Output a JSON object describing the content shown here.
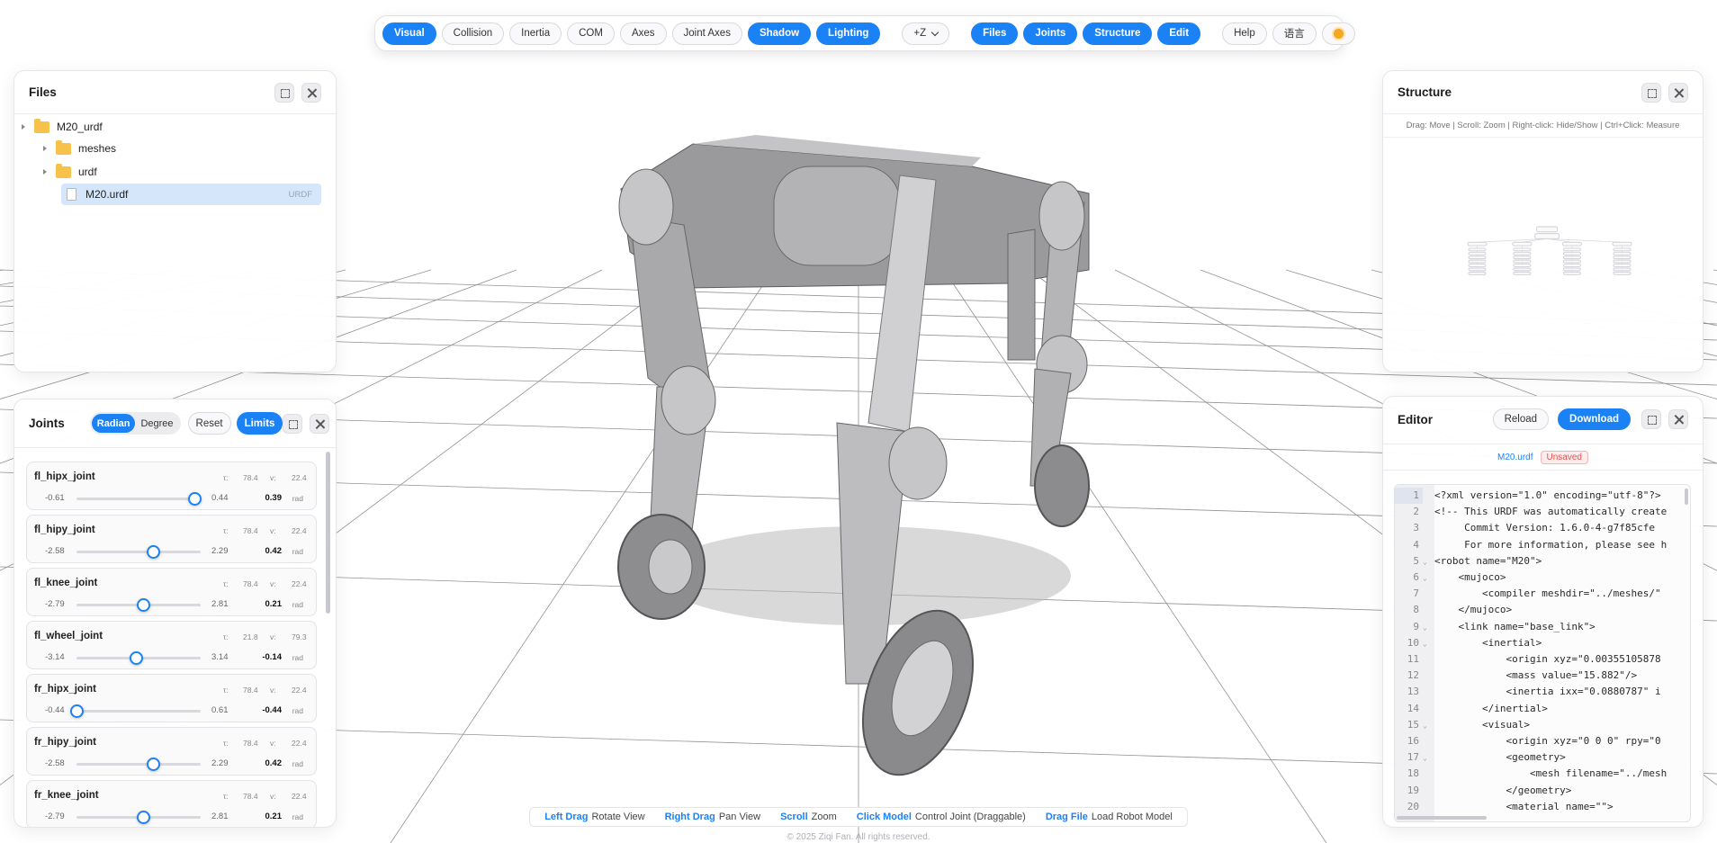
{
  "toolbar": {
    "view_toggles": [
      {
        "label": "Visual",
        "on": true
      },
      {
        "label": "Collision",
        "on": false
      },
      {
        "label": "Inertia",
        "on": false
      },
      {
        "label": "COM",
        "on": false
      },
      {
        "label": "Axes",
        "on": false
      },
      {
        "label": "Joint Axes",
        "on": false
      },
      {
        "label": "Shadow",
        "on": true
      },
      {
        "label": "Lighting",
        "on": true
      }
    ],
    "up_axis": "+Z",
    "panel_toggles": [
      {
        "label": "Files",
        "on": true
      },
      {
        "label": "Joints",
        "on": true
      },
      {
        "label": "Structure",
        "on": true
      },
      {
        "label": "Edit",
        "on": true
      }
    ],
    "help_label": "Help",
    "lang_label": "语言",
    "theme_icon": "sun-icon"
  },
  "files_panel": {
    "title": "Files",
    "tree": [
      {
        "name": "M20_urdf",
        "kind": "folder"
      },
      {
        "name": "meshes",
        "kind": "folder"
      },
      {
        "name": "urdf",
        "kind": "folder"
      },
      {
        "name": "M20.urdf",
        "kind": "file",
        "tag": "URDF",
        "selected": true
      }
    ]
  },
  "structure_panel": {
    "title": "Structure",
    "hint": "Drag: Move | Scroll: Zoom | Right-click: Hide/Show | Ctrl+Click: Measure"
  },
  "joints_panel": {
    "title": "Joints",
    "unit_options": [
      "Radian",
      "Degree"
    ],
    "unit_selected": "Radian",
    "reset_label": "Reset",
    "limits_label": "Limits",
    "joints": [
      {
        "name": "fl_hipx_joint",
        "tau": "78.4",
        "vel": "22.4",
        "min": "-0.61",
        "max": "0.44",
        "value": "0.39",
        "unit": "rad"
      },
      {
        "name": "fl_hipy_joint",
        "tau": "78.4",
        "vel": "22.4",
        "min": "-2.58",
        "max": "2.29",
        "value": "0.42",
        "unit": "rad"
      },
      {
        "name": "fl_knee_joint",
        "tau": "78.4",
        "vel": "22.4",
        "min": "-2.79",
        "max": "2.81",
        "value": "0.21",
        "unit": "rad"
      },
      {
        "name": "fl_wheel_joint",
        "tau": "21.8",
        "vel": "79.3",
        "min": "-3.14",
        "max": "3.14",
        "value": "-0.14",
        "unit": "rad"
      },
      {
        "name": "fr_hipx_joint",
        "tau": "78.4",
        "vel": "22.4",
        "min": "-0.44",
        "max": "0.61",
        "value": "-0.44",
        "unit": "rad"
      },
      {
        "name": "fr_hipy_joint",
        "tau": "78.4",
        "vel": "22.4",
        "min": "-2.58",
        "max": "2.29",
        "value": "0.42",
        "unit": "rad"
      },
      {
        "name": "fr_knee_joint",
        "tau": "78.4",
        "vel": "22.4",
        "min": "-2.79",
        "max": "2.81",
        "value": "0.21",
        "unit": "rad"
      }
    ],
    "tau_label": "τ:",
    "vel_label": "v:"
  },
  "editor_panel": {
    "title": "Editor",
    "reload_label": "Reload",
    "download_label": "Download",
    "filename": "M20.urdf",
    "status": "Unsaved",
    "lines": [
      {
        "n": "1",
        "fold": false,
        "text": "<?xml version=\"1.0\" encoding=\"utf-8\"?>"
      },
      {
        "n": "2",
        "fold": false,
        "text": "<!-- This URDF was automatically create"
      },
      {
        "n": "3",
        "fold": false,
        "text": "     Commit Version: 1.6.0-4-g7f85cfe"
      },
      {
        "n": "4",
        "fold": false,
        "text": "     For more information, please see h"
      },
      {
        "n": "5",
        "fold": true,
        "text": "<robot name=\"M20\">"
      },
      {
        "n": "6",
        "fold": true,
        "text": "    <mujoco>"
      },
      {
        "n": "7",
        "fold": false,
        "text": "        <compiler meshdir=\"../meshes/\""
      },
      {
        "n": "8",
        "fold": false,
        "text": "    </mujoco>"
      },
      {
        "n": "9",
        "fold": true,
        "text": "    <link name=\"base_link\">"
      },
      {
        "n": "10",
        "fold": true,
        "text": "        <inertial>"
      },
      {
        "n": "11",
        "fold": false,
        "text": "            <origin xyz=\"0.00355105878"
      },
      {
        "n": "12",
        "fold": false,
        "text": "            <mass value=\"15.882\"/>"
      },
      {
        "n": "13",
        "fold": false,
        "text": "            <inertia ixx=\"0.0880787\" i"
      },
      {
        "n": "14",
        "fold": false,
        "text": "        </inertial>"
      },
      {
        "n": "15",
        "fold": true,
        "text": "        <visual>"
      },
      {
        "n": "16",
        "fold": false,
        "text": "            <origin xyz=\"0 0 0\" rpy=\"0"
      },
      {
        "n": "17",
        "fold": true,
        "text": "            <geometry>"
      },
      {
        "n": "18",
        "fold": false,
        "text": "                <mesh filename=\"../mesh"
      },
      {
        "n": "19",
        "fold": false,
        "text": "            </geometry>"
      },
      {
        "n": "20",
        "fold": false,
        "text": "            <material name=\"\">"
      }
    ]
  },
  "hints": [
    {
      "key": "Left Drag",
      "desc": "Rotate View"
    },
    {
      "key": "Right Drag",
      "desc": "Pan View"
    },
    {
      "key": "Scroll",
      "desc": "Zoom"
    },
    {
      "key": "Click Model",
      "desc": "Control Joint (Draggable)"
    },
    {
      "key": "Drag File",
      "desc": "Load Robot Model"
    }
  ],
  "copyright": "© 2025 Ziqi Fan. All rights reserved.",
  "colors": {
    "accent": "#1a82f5",
    "folder": "#f6c24b",
    "unsaved": "#e05353"
  }
}
